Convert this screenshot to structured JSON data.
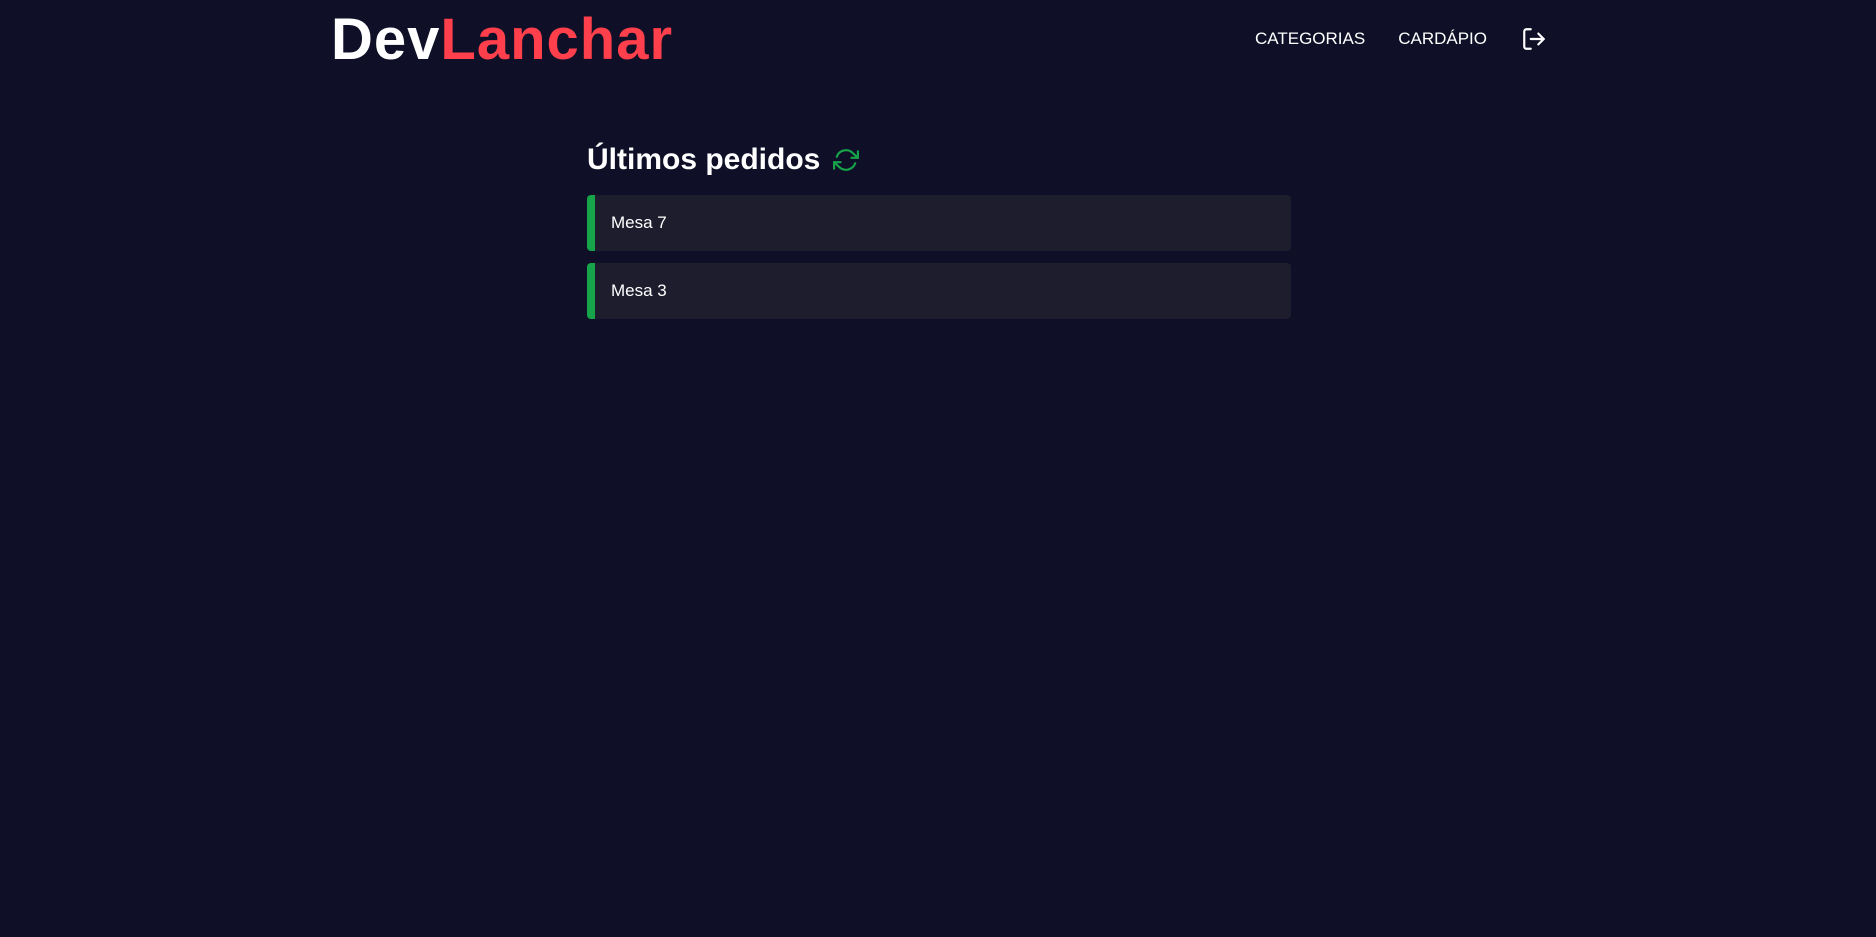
{
  "brand": {
    "part_a": "Dev",
    "part_b": "Lanchar",
    "color_a": "#ffffff",
    "color_b": "#ff3f4b"
  },
  "nav": {
    "items": [
      {
        "label": "CATEGORIAS"
      },
      {
        "label": "CARDÁPIO"
      }
    ],
    "logout_icon": "logout-icon"
  },
  "main": {
    "title": "Últimos pedidos",
    "refresh_icon": "refresh-icon",
    "accent_color": "#16a34a",
    "orders": [
      {
        "label": "Mesa 7"
      },
      {
        "label": "Mesa 3"
      }
    ]
  },
  "colors": {
    "background": "#0f1027",
    "card": "#1e1d2e"
  }
}
